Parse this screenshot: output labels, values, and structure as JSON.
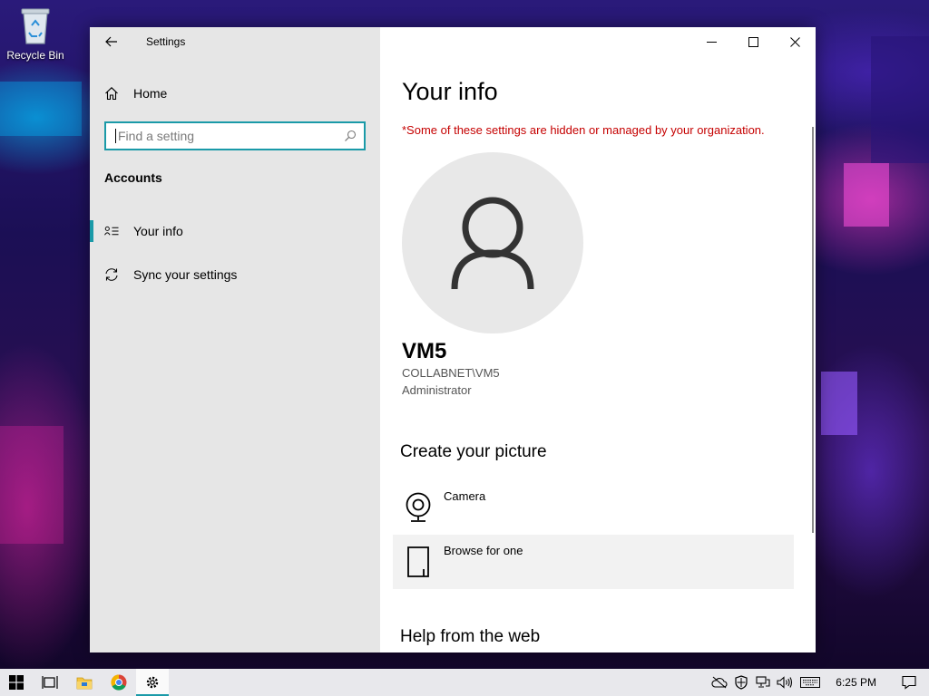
{
  "desktop": {
    "icons": [
      {
        "label": "Recycle Bin",
        "icon": "recycle-bin-icon"
      }
    ]
  },
  "window": {
    "app_title": "Settings",
    "nav": {
      "home_label": "Home",
      "search_placeholder": "Find a setting",
      "section_label": "Accounts",
      "items": [
        {
          "label": "Your info",
          "icon": "contact-card-icon",
          "active": true
        },
        {
          "label": "Sync your settings",
          "icon": "sync-icon",
          "active": false
        }
      ]
    },
    "content": {
      "title": "Your info",
      "org_notice": "*Some of these settings are hidden or managed by your organization.",
      "user": {
        "name": "VM5",
        "domain_account": "COLLABNET\\VM5",
        "role": "Administrator"
      },
      "create_picture_heading": "Create your picture",
      "picture_options": [
        {
          "label": "Camera",
          "icon": "webcam-icon"
        },
        {
          "label": "Browse for one",
          "icon": "file-icon"
        }
      ],
      "help_heading": "Help from the web"
    },
    "accent_color": "#1a9aa8",
    "notice_color": "#c50000"
  },
  "taskbar": {
    "apps": [
      "start-icon",
      "task-view-icon",
      "file-explorer-icon",
      "chrome-icon",
      "settings-icon"
    ],
    "tray_icons": [
      "onedrive-offline-icon",
      "security-icon",
      "network-icon",
      "volume-icon",
      "keyboard-icon"
    ],
    "clock": "6:25 PM"
  }
}
